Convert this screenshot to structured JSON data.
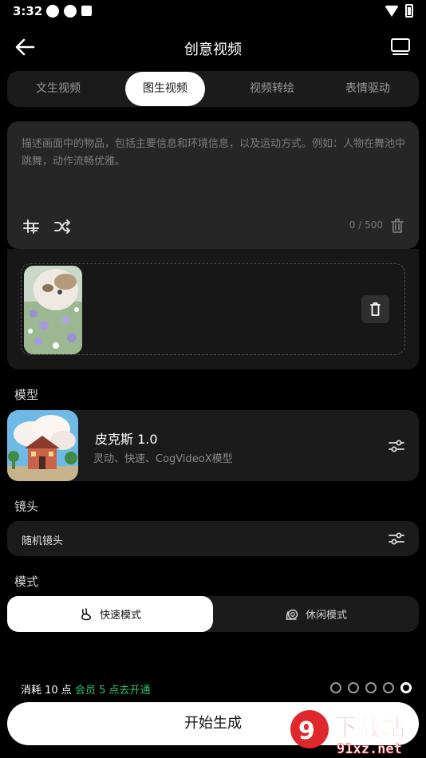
{
  "status_bar": {
    "time": "3:32"
  },
  "header": {
    "title": "创意视频"
  },
  "tabs": [
    {
      "label": "文生视频"
    },
    {
      "label": "图生视频"
    },
    {
      "label": "视频转绘"
    },
    {
      "label": "表情驱动"
    }
  ],
  "active_tab": "图生视频",
  "prompt": {
    "placeholder": "描述画面中的物品，包括主要信息和环境信息，以及运动方式。例如：人物在舞池中跳舞，动作流畅优雅。",
    "counter": "0 / 500"
  },
  "model_section": {
    "label": "模型",
    "name": "皮克斯 1.0",
    "description": "灵动、快速、CogVideoX模型"
  },
  "lens_section": {
    "label": "镜头",
    "value": "随机镜头"
  },
  "mode_section": {
    "label": "模式",
    "options": [
      {
        "label": "快速模式",
        "icon": "rabbit-icon"
      },
      {
        "label": "休闲模式",
        "icon": "snail-icon"
      }
    ],
    "active": "快速模式"
  },
  "footer": {
    "cost_prefix": "消耗 10 点",
    "member_text": "会员 5 点去开通",
    "page_dots": 5,
    "active_dot": 5,
    "generate_label": "开始生成"
  },
  "watermark": {
    "text_top": "下载站",
    "text_bottom": "91xz.net"
  },
  "colors": {
    "accent_green": "#27c46a",
    "background": "#000000",
    "card": "#1b1b1b",
    "watermark_red": "#e0272b"
  }
}
